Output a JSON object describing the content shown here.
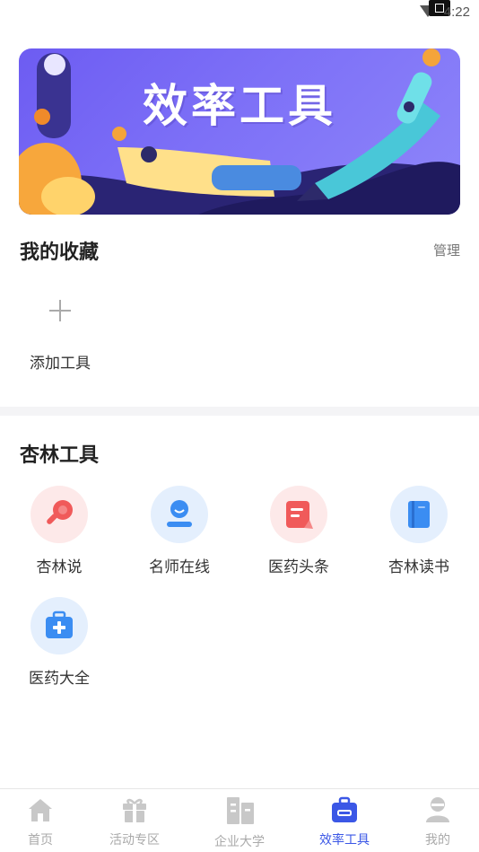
{
  "status_bar": {
    "time": "4:22"
  },
  "banner": {
    "title": "效率工具"
  },
  "favorites": {
    "title": "我的收藏",
    "manage_label": "管理",
    "add_tool_label": "添加工具"
  },
  "tools_section": {
    "title": "杏林工具",
    "items": [
      {
        "label": "杏林说",
        "icon": "microphone-icon",
        "bg": "#fde9e9",
        "color": "#f05a5a"
      },
      {
        "label": "名师在线",
        "icon": "teacher-icon",
        "bg": "#e4effd",
        "color": "#3b8df2"
      },
      {
        "label": "医药头条",
        "icon": "news-icon",
        "bg": "#fde9e9",
        "color": "#f05a5a"
      },
      {
        "label": "杏林读书",
        "icon": "book-icon",
        "bg": "#e4effd",
        "color": "#3b8df2"
      },
      {
        "label": "医药大全",
        "icon": "medkit-icon",
        "bg": "#e4effd",
        "color": "#3b8df2"
      }
    ]
  },
  "bottom_nav": {
    "items": [
      {
        "label": "首页",
        "icon": "home-icon"
      },
      {
        "label": "活动专区",
        "icon": "gift-icon"
      },
      {
        "label": "企业大学",
        "icon": "building-icon"
      },
      {
        "label": "效率工具",
        "icon": "toolbox-icon",
        "active": true
      },
      {
        "label": "我的",
        "icon": "user-icon"
      }
    ],
    "active_color": "#3b57e6",
    "inactive_color": "#c8c8c8"
  }
}
